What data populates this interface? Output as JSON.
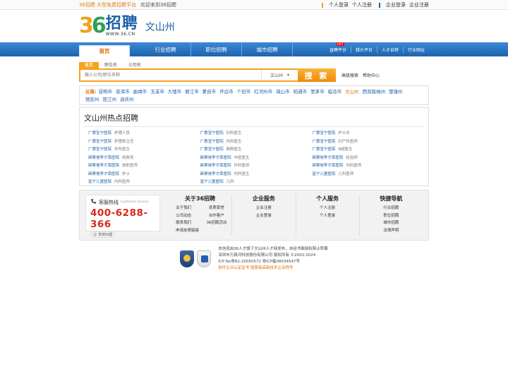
{
  "topbar": {
    "brand": "36招聘 大型免费招聘平台",
    "welcome": "欢迎来到36招聘",
    "personal_login": "个人登录",
    "personal_register": "个人注册",
    "company_login": "企业登录",
    "company_register": "企业注册"
  },
  "header": {
    "logo_num_1": "3",
    "logo_num_2": "6",
    "logo_cn": "招聘",
    "logo_url": "WWW.36.CN",
    "city": "文山州"
  },
  "nav": {
    "items": [
      "首页",
      "行业招聘",
      "职位招聘",
      "城市招聘"
    ],
    "right": [
      "直聘平台",
      "猎头平台",
      "人才自荐",
      "行业网址"
    ],
    "hot_badge": "HOT"
  },
  "search": {
    "tabs": [
      "全文",
      "职位名",
      "公司名"
    ],
    "placeholder": "输入公司/职位名称",
    "city_select": "文山州",
    "button": "搜 索",
    "advanced": "高级搜索",
    "help": "帮助中心"
  },
  "citybar": {
    "label": "云南:",
    "cities": [
      "昆明市",
      "普洱市",
      "曲靖市",
      "玉溪市",
      "大理市",
      "丽江市",
      "蒙自市",
      "开远市",
      "个旧市",
      "红河州市",
      "保山市",
      "昭通市",
      "思茅市",
      "临沧市",
      "文山州",
      "西双版纳州",
      "楚雄州",
      "德宏州",
      "怒江州",
      "迪庆州"
    ],
    "active_city": "文山州"
  },
  "hotjobs": {
    "title": "文山州热点招聘",
    "jobs": [
      {
        "company": "广惠宝宁医院",
        "position": "护理人员"
      },
      {
        "company": "广惠宝宁医院",
        "position": "妇科医生"
      },
      {
        "company": "广惠宝宁医院",
        "position": "护士长"
      },
      {
        "company": "广惠宝宁医院",
        "position": "护理部主任"
      },
      {
        "company": "广惠宝宁医院",
        "position": "内科医生"
      },
      {
        "company": "广惠宝宁医院",
        "position": "妇产科医师"
      },
      {
        "company": "广惠宝宁医院",
        "position": "外科医生"
      },
      {
        "company": "广惠宝宁医院",
        "position": "麻醉医生"
      },
      {
        "company": "广惠宝宁医院",
        "position": "B超医生"
      },
      {
        "company": "麻栗坡李才荣医院",
        "position": "收费员"
      },
      {
        "company": "麻栗坡李才荣医院",
        "position": "中医医生"
      },
      {
        "company": "麻栗坡李才荣医院",
        "position": "检验师"
      },
      {
        "company": "麻栗坡李才荣医院",
        "position": "放射医师"
      },
      {
        "company": "麻栗坡李才荣医院",
        "position": "外科医师"
      },
      {
        "company": "麻栗坡李才荣医院",
        "position": "内科医师"
      },
      {
        "company": "麻栗坡李才荣医院",
        "position": "护士"
      },
      {
        "company": "麻栗坡李才荣医院",
        "position": "内科医生"
      },
      {
        "company": "富宁儿童医院",
        "position": "儿科医师"
      },
      {
        "company": "富宁儿童医院",
        "position": "内科医师"
      },
      {
        "company": "富宁儿童医院",
        "position": "儿科"
      }
    ]
  },
  "footer": {
    "hotline_label": "客服热线",
    "hotline_en": "Customer Service",
    "hotline_number": "400-6288-366",
    "prize": "有奖纠错",
    "cols": [
      {
        "title": "关于36招聘",
        "links": [
          "关于我们",
          "资质荣誉",
          "公司动态",
          "合作客户",
          "联系我们",
          "36招聘活动",
          "申请友情链接"
        ]
      },
      {
        "title": "企业服务",
        "links": [
          "企业注册",
          "企业登录"
        ]
      },
      {
        "title": "个人服务",
        "links": [
          "个人注册",
          "个人登录"
        ]
      },
      {
        "title": "快捷导航",
        "links": [
          "行业招聘",
          "职位招聘",
          "城市招聘",
          "法律声明"
        ]
      }
    ]
  },
  "copyright": {
    "line1": "本信息由36人才旗下文山州人才网发布，未经书面授权禁止转载",
    "line2": "深圳市万泉河科技股份有限公司 版权所有 ©2002-2024",
    "line3": "ICP No粤B2-20050572   粤ICP备08034547号",
    "line4": "软件企业认定证书   国家级高新技术企业称号"
  }
}
